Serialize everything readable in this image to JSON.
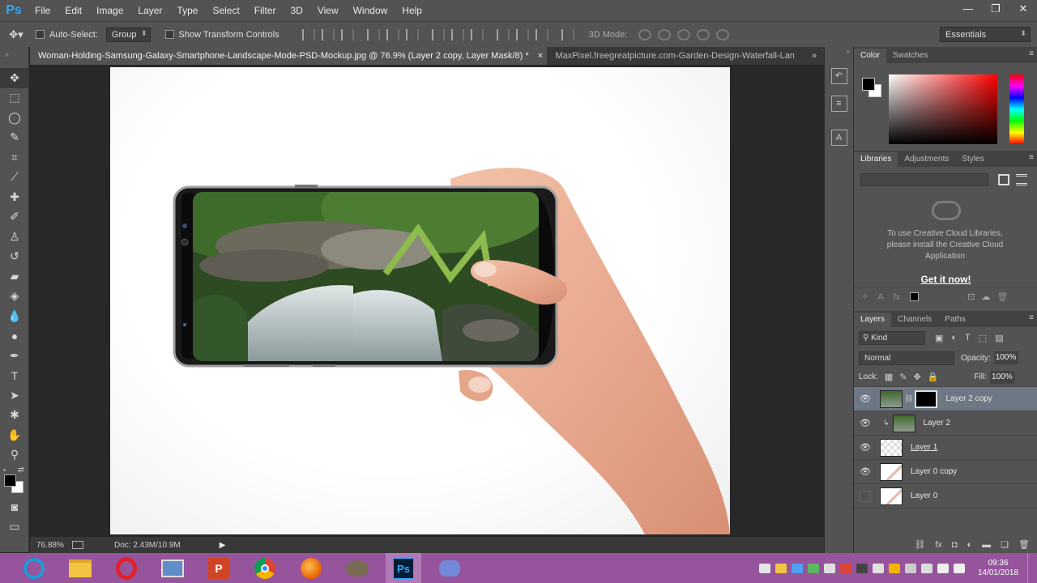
{
  "app": {
    "logo": "Ps"
  },
  "menu": [
    "File",
    "Edit",
    "Image",
    "Layer",
    "Type",
    "Select",
    "Filter",
    "3D",
    "View",
    "Window",
    "Help"
  ],
  "window_controls": {
    "minimize": "—",
    "restore": "❐",
    "close": "✕"
  },
  "options": {
    "auto_select_label": "Auto-Select:",
    "auto_select_value": "Group",
    "transform_label": "Show Transform Controls",
    "mode3d_label": "3D Mode:",
    "workspace": "Essentials"
  },
  "tabs": [
    {
      "label": "Woman-Holding-Samsung-Galaxy-Smartphone-Landscape-Mode-PSD-Mockup.jpg @ 76.9% (Layer 2 copy, Layer Mask/8) *",
      "close": "×"
    },
    {
      "label": "MaxPixel.freegreatpicture.com-Garden-Design-Waterfall-Lan"
    }
  ],
  "tabs_overflow": "»",
  "status": {
    "zoom": "76.88%",
    "doc": "Doc: 2.43M/10.9M",
    "arrow": "▶"
  },
  "color_panel": {
    "tabs": [
      "Color",
      "Swatches"
    ]
  },
  "libraries_panel": {
    "tabs": [
      "Libraries",
      "Adjustments",
      "Styles"
    ],
    "message": "To use Creative Cloud Libraries, please install the Creative Cloud Application",
    "cta": "Get it now!"
  },
  "layers_panel": {
    "tabs": [
      "Layers",
      "Channels",
      "Paths"
    ],
    "kind": "Kind",
    "blend_mode": "Normal",
    "opacity_label": "Opacity:",
    "opacity_value": "100%",
    "lock_label": "Lock:",
    "fill_label": "Fill:",
    "fill_value": "100%",
    "layers": [
      {
        "name": "Layer 2 copy",
        "visible": true,
        "selected": true
      },
      {
        "name": "Layer 2",
        "visible": true,
        "selected": false
      },
      {
        "name": "Layer 1",
        "visible": true,
        "selected": false
      },
      {
        "name": "Layer 0 copy",
        "visible": true,
        "selected": false
      },
      {
        "name": "Layer 0",
        "visible": false,
        "selected": false
      }
    ]
  },
  "clock": {
    "time": "09:36",
    "date": "14/01/2018"
  },
  "colors": {
    "chrome": "#535353",
    "canvas_bg": "#282828",
    "selected_layer": "#6e7784",
    "taskbar": "#95549c",
    "ps_blue": "#31a8ff"
  }
}
